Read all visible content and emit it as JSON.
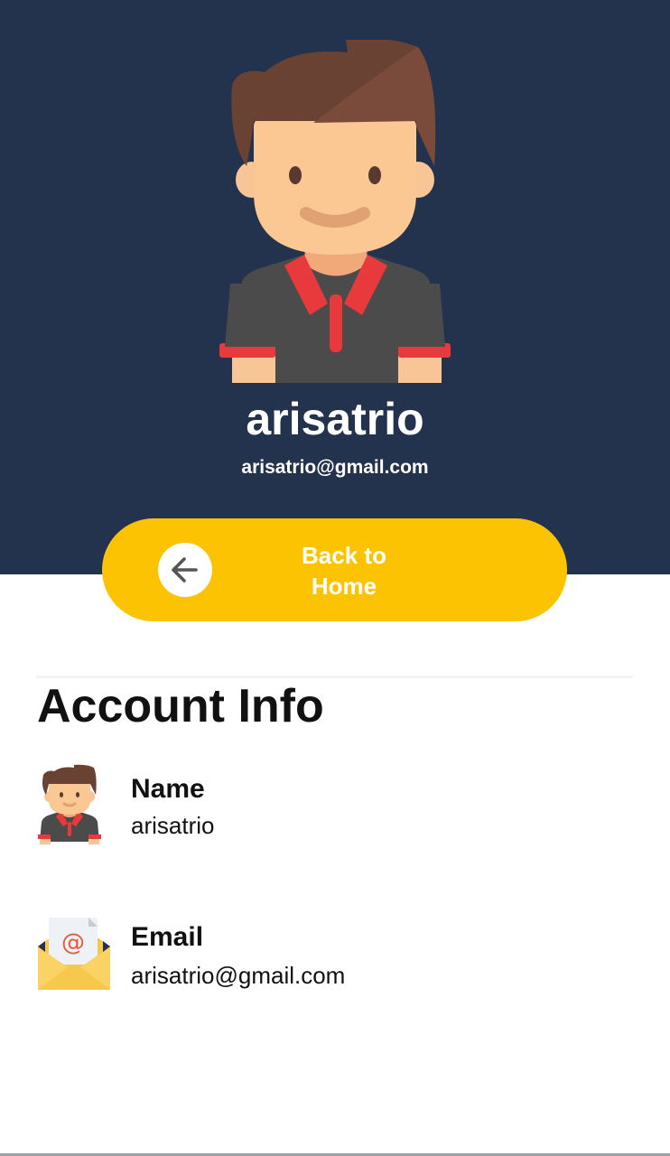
{
  "profile": {
    "username": "arisatrio",
    "email": "arisatrio@gmail.com",
    "avatar_icon": "man-avatar-icon"
  },
  "back_button": {
    "label": "Back to\nHome",
    "icon": "arrow-left-icon",
    "color": "#fcc302"
  },
  "account_info": {
    "title": "Account Info",
    "items": [
      {
        "label": "Name",
        "value": "arisatrio",
        "icon": "man-avatar-icon"
      },
      {
        "label": "Email",
        "value": "arisatrio@gmail.com",
        "icon": "email-envelope-icon"
      }
    ]
  },
  "colors": {
    "header_bg": "#23324d",
    "accent": "#fcc302",
    "text": "#111111"
  }
}
